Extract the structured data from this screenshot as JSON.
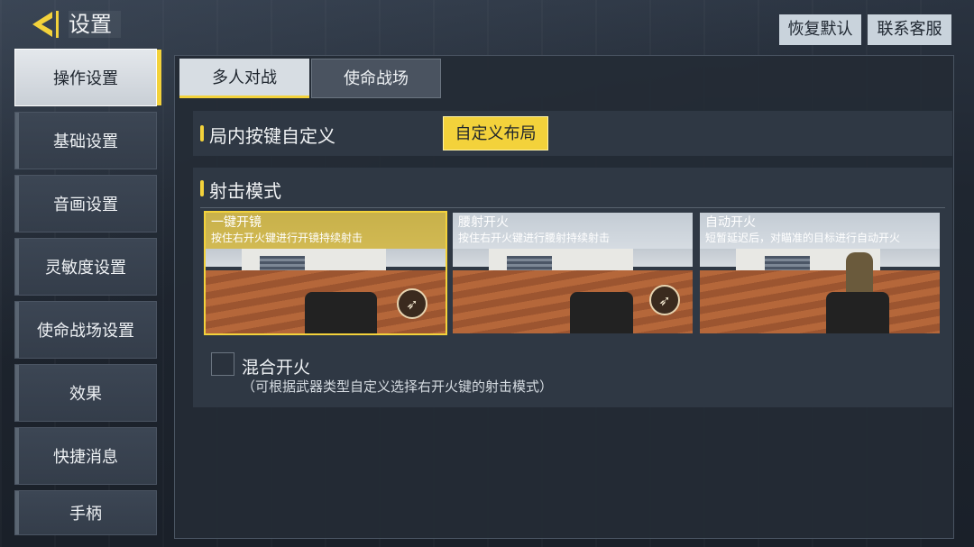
{
  "header": {
    "title": "设置",
    "reset_label": "恢复默认",
    "contact_label": "联系客服"
  },
  "sidebar": {
    "items": [
      {
        "label": "操作设置",
        "active": true
      },
      {
        "label": "基础设置"
      },
      {
        "label": "音画设置"
      },
      {
        "label": "灵敏度设置"
      },
      {
        "label": "使命战场设置"
      },
      {
        "label": "效果"
      },
      {
        "label": "快捷消息"
      },
      {
        "label": "手柄"
      }
    ]
  },
  "tabs": [
    {
      "label": "多人对战",
      "active": true
    },
    {
      "label": "使命战场"
    }
  ],
  "custom_keys": {
    "title": "局内按键自定义",
    "button_label": "自定义布局"
  },
  "fire_mode": {
    "title": "射击模式",
    "modes": [
      {
        "title": "一键开镜",
        "desc": "按住右开火键进行开镜持续射击",
        "selected": true
      },
      {
        "title": "腰射开火",
        "desc": "按住右开火键进行腰射持续射击"
      },
      {
        "title": "自动开火",
        "desc": "短暂延迟后，对瞄准的目标进行自动开火"
      }
    ],
    "mixed_label": "混合开火",
    "mixed_hint": "（可根据武器类型自定义选择右开火键的射击模式）",
    "mixed_checked": false
  },
  "colors": {
    "accent": "#f3d23b",
    "panel": "#2f3844"
  }
}
